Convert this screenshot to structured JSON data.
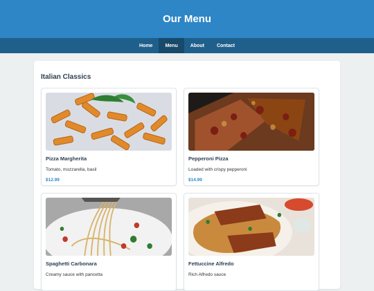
{
  "header": {
    "title": "Our Menu"
  },
  "nav": {
    "items": [
      {
        "label": "Home",
        "active": false
      },
      {
        "label": "Menu",
        "active": true
      },
      {
        "label": "About",
        "active": false
      },
      {
        "label": "Contact",
        "active": false
      }
    ]
  },
  "section": {
    "title": "Italian Classics"
  },
  "items": [
    {
      "name": "Pizza Margherita",
      "description": "Tomato, mozzarella, basil",
      "price": "$12.99",
      "image": "penne-pasta"
    },
    {
      "name": "Pepperoni Pizza",
      "description": "Loaded with crispy pepperoni",
      "price": "$14.99",
      "image": "pizza-slices"
    },
    {
      "name": "Spaghetti Carbonara",
      "description": "Creamy sauce with pancetta",
      "price": "",
      "image": "spaghetti-fork"
    },
    {
      "name": "Fettuccine Alfredo",
      "description": "Rich Alfredo sauce",
      "price": "",
      "image": "ribs-rice"
    }
  ],
  "colors": {
    "accent": "#2e86c6",
    "nav": "#1f5f8b",
    "nav_active": "#174a6b",
    "background": "#ecf0f1"
  }
}
